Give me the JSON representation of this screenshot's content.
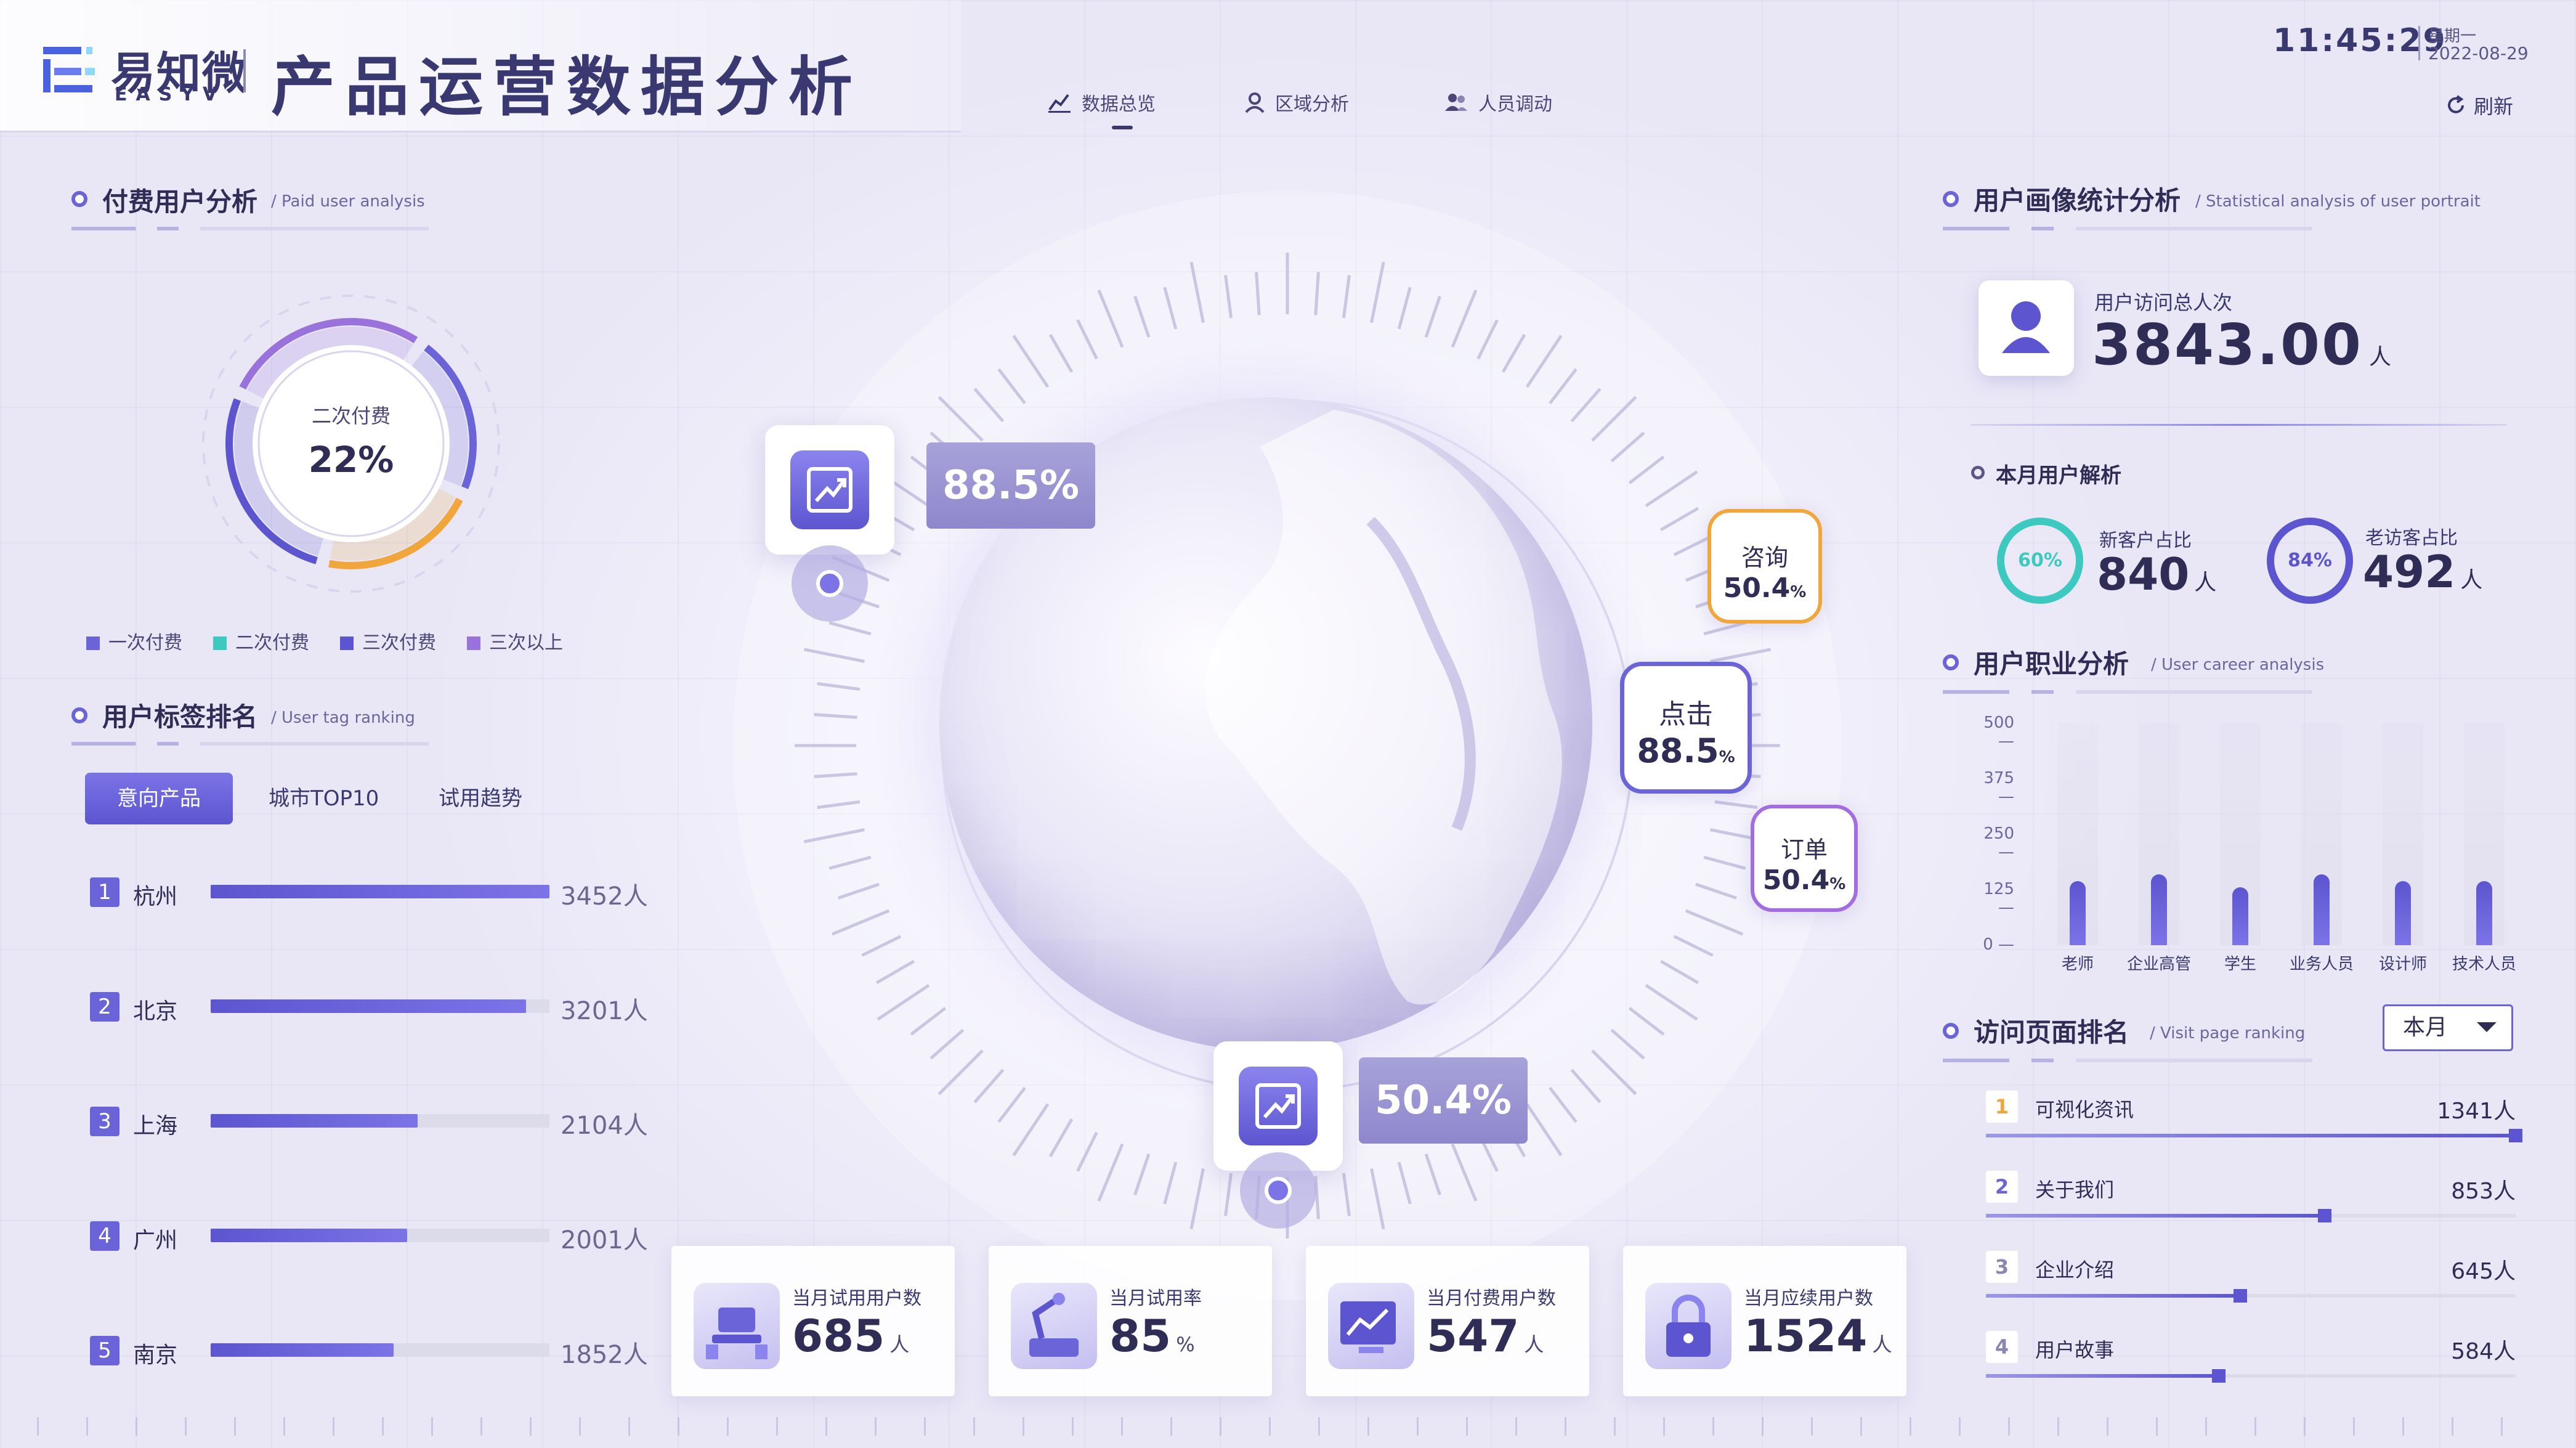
{
  "header": {
    "logo_cn": "易知微",
    "logo_en": "EASYV",
    "title": "产品运营数据分析",
    "time": "11:45:29",
    "weekday": "星期一",
    "date": "2022-08-29",
    "refresh_label": "刷新",
    "nav": [
      {
        "label": "数据总览",
        "icon": "chart-icon"
      },
      {
        "label": "区域分析",
        "icon": "location-icon"
      },
      {
        "label": "人员调动",
        "icon": "users-icon"
      }
    ]
  },
  "paid_users": {
    "title": "付费用户分析",
    "subtitle": "Paid user analysis",
    "center_label": "二次付费",
    "center_value": "22%",
    "segments": [
      {
        "name": "一次付费",
        "color": "#6b63d8",
        "share": 0.22
      },
      {
        "name": "二次付费",
        "color": "#f0a63a",
        "share": 0.22
      },
      {
        "name": "三次付费",
        "color": "#5d55cf",
        "share": 0.28
      },
      {
        "name": "三次以上",
        "color": "#9a72dc",
        "share": 0.28
      }
    ],
    "legend": [
      {
        "label": "一次付费",
        "color": "#6b63d8"
      },
      {
        "label": "二次付费",
        "color": "#3dc9c0"
      },
      {
        "label": "三次付费",
        "color": "#5d55cf"
      },
      {
        "label": "三次以上",
        "color": "#9a72dc"
      }
    ]
  },
  "tag_ranking": {
    "title": "用户标签排名",
    "subtitle": "User tag ranking",
    "tabs": [
      "意向产品",
      "城市TOP10",
      "试用趋势"
    ],
    "rows": [
      {
        "rank": "1",
        "city": "杭州",
        "value": "3452人",
        "ratio": 1.0
      },
      {
        "rank": "2",
        "city": "北京",
        "value": "3201人",
        "ratio": 0.93
      },
      {
        "rank": "3",
        "city": "上海",
        "value": "2104人",
        "ratio": 0.61
      },
      {
        "rank": "4",
        "city": "广州",
        "value": "2001人",
        "ratio": 0.58
      },
      {
        "rank": "5",
        "city": "南京",
        "value": "1852人",
        "ratio": 0.54
      }
    ]
  },
  "globe": {
    "pin_top_value": "88.5%",
    "pin_bottom_value": "50.4%",
    "bubbles": [
      {
        "label": "咨询",
        "value": "50.4",
        "unit": "%",
        "color": "#f0a63a"
      },
      {
        "label": "点击",
        "value": "88.5",
        "unit": "%",
        "color": "#6b63d8"
      },
      {
        "label": "订单",
        "value": "50.4",
        "unit": "%",
        "color": "#a36ce0"
      }
    ]
  },
  "stats": [
    {
      "label": "当月试用用户数",
      "value": "685",
      "unit": "人"
    },
    {
      "label": "当月试用率",
      "value": "85",
      "unit": "%"
    },
    {
      "label": "当月付费用户数",
      "value": "547",
      "unit": "人"
    },
    {
      "label": "当月应续用户数",
      "value": "1524",
      "unit": "人"
    }
  ],
  "portrait": {
    "title": "用户画像统计分析",
    "subtitle": "Statistical analysis of user portrait",
    "visits_label": "用户访问总人次",
    "visits_value": "3843.00",
    "visits_unit": "人",
    "month_title": "本月用户解析",
    "new_label": "新客户占比",
    "new_pct": "60%",
    "new_value": "840",
    "old_label": "老访客占比",
    "old_pct": "84%",
    "old_value": "492",
    "unit": "人",
    "new_color": "#3dc9c0",
    "old_color": "#5d55cf"
  },
  "career": {
    "title": "用户职业分析",
    "subtitle": "User career analysis"
  },
  "chart_data": {
    "type": "bar",
    "categories": [
      "老师",
      "企业高管",
      "学生",
      "业务人员",
      "设计师",
      "技术人员"
    ],
    "values": [
      145,
      160,
      130,
      160,
      145,
      145
    ],
    "ylim": [
      0,
      500
    ],
    "yticks": [
      500,
      375,
      250,
      125,
      0
    ],
    "grid": false,
    "color": "#5d55cf"
  },
  "visit_ranking": {
    "title": "访问页面排名",
    "subtitle": "Visit page ranking",
    "select": "本月",
    "rows": [
      {
        "rank": "1",
        "name": "可视化资讯",
        "value": "1341人",
        "ratio": 1.0,
        "color": "#f0a63a"
      },
      {
        "rank": "2",
        "name": "关于我们",
        "value": "853人",
        "ratio": 0.64,
        "color": "#6b63d8"
      },
      {
        "rank": "3",
        "name": "企业介绍",
        "value": "645人",
        "ratio": 0.48,
        "color": "#8a86b4"
      },
      {
        "rank": "4",
        "name": "用户故事",
        "value": "584人",
        "ratio": 0.44,
        "color": "#8a86b4"
      }
    ]
  }
}
